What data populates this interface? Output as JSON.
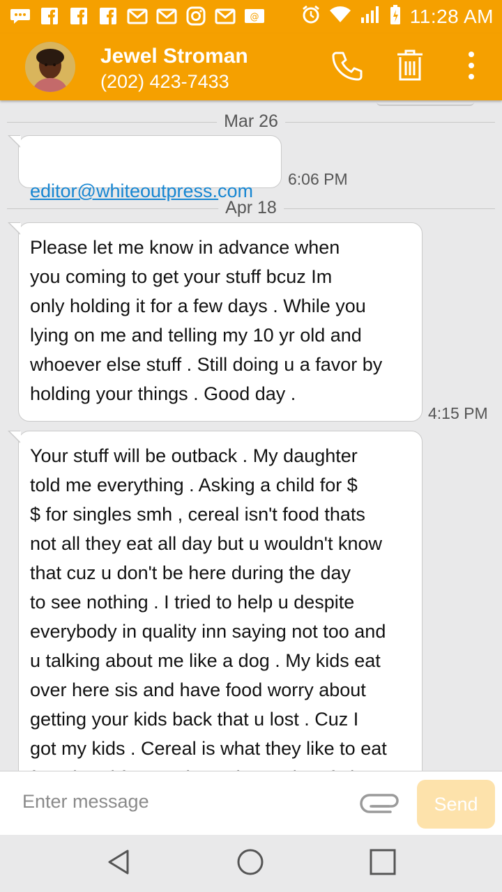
{
  "status_bar": {
    "time": "11:28 AM",
    "notification_icons": [
      "chat-icon",
      "facebook-icon",
      "facebook-icon",
      "facebook-icon",
      "gmail-icon",
      "gmail-icon",
      "instagram-icon",
      "gmail-icon",
      "email-icon"
    ],
    "system_icons": [
      "alarm-icon",
      "wifi-icon",
      "signal-icon",
      "battery-icon"
    ]
  },
  "header": {
    "contact_name": "Jewel Stroman",
    "contact_phone": "(202) 423-7433",
    "accent_color": "#f5a000"
  },
  "conversation": {
    "groups": [
      {
        "date": "Mar 26",
        "messages": [
          {
            "text": "editor@whiteoutpress.com",
            "time": "6:06 PM"
          }
        ]
      },
      {
        "date": "Apr 18",
        "messages": [
          {
            "text": "Please let me know in advance when\nyou coming to get your stuff bcuz Im\nonly holding it for a few days . While you\nlying on me and telling my 10 yr old and\nwhoever else stuff . Still doing u a favor by\nholding your things . Good day .",
            "time": "4:15 PM"
          },
          {
            "text": "Your stuff will be outback . My daughter\ntold me everything . Asking a child for $\n$ for singles smh , cereal isn't food thats\nnot all they eat all day but u wouldn't know\nthat cuz u don't be here during the day\nto see nothing . I tried to help u despite\neverybody in quality inn saying not too and\nu talking about me like a dog . My kids eat\nover here sis and have food worry about\ngetting your kids back that u lost . Cuz I\ngot my kids . Cereal is what they like to eat\nfor a breakfast . Rdy     getting an b...t f...k",
            "time": ""
          }
        ]
      }
    ]
  },
  "composer": {
    "placeholder": "Enter message",
    "send_label": "Send"
  },
  "nav": {
    "buttons": [
      "back-icon",
      "home-icon",
      "recents-icon"
    ]
  }
}
